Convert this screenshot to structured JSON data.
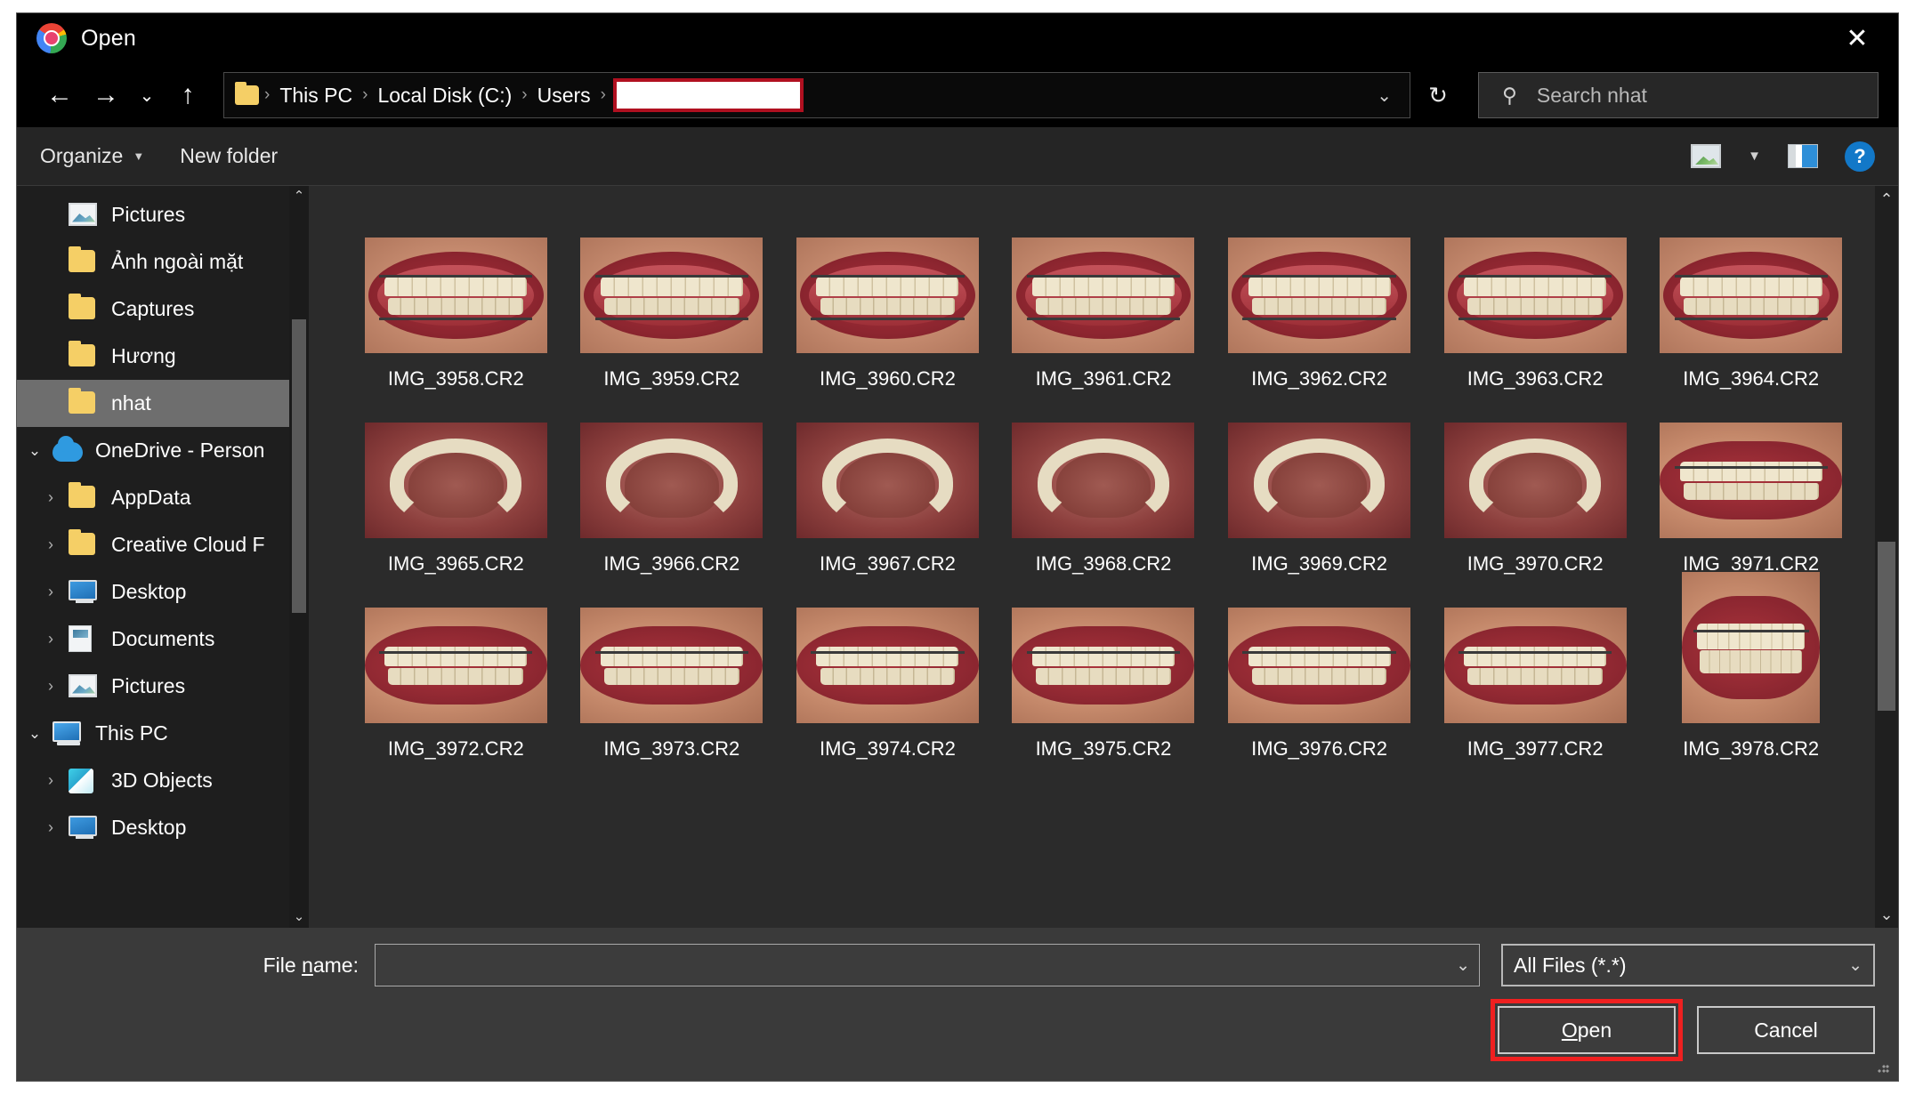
{
  "window": {
    "title": "Open",
    "app_icon": "chrome-icon",
    "close_label": "✕"
  },
  "nav": {
    "back_icon": "←",
    "forward_icon": "→",
    "recent_icon": "⌄",
    "up_icon": "↑",
    "refresh_icon": "↻",
    "address_caret": "⌄",
    "breadcrumbs": [
      {
        "label": "This PC"
      },
      {
        "label": "Local Disk (C:)"
      },
      {
        "label": "Users"
      }
    ],
    "separator": "›",
    "redacted_segment": "",
    "search_placeholder": "Search nhat",
    "search_value": "",
    "search_icon": "⚲"
  },
  "commandbar": {
    "organize_label": "Organize",
    "organize_caret": "▼",
    "new_folder_label": "New folder",
    "view_icon": "view-icon",
    "view_caret": "▼",
    "preview_pane_icon": "preview-pane-icon",
    "help_label": "?"
  },
  "sidebar": {
    "scroll_up_icon": "⌃",
    "scroll_down_icon": "⌄",
    "items": [
      {
        "label": "Pictures",
        "icon": "picture-icon",
        "indent": 1,
        "chevron": "",
        "pinned": true,
        "selected": false
      },
      {
        "label": "Ảnh ngoài mặt",
        "icon": "folder-icon",
        "indent": 1,
        "chevron": "",
        "pinned": false,
        "selected": false
      },
      {
        "label": "Captures",
        "icon": "folder-icon",
        "indent": 1,
        "chevron": "",
        "pinned": false,
        "selected": false
      },
      {
        "label": "Hương",
        "icon": "folder-icon",
        "indent": 1,
        "chevron": "",
        "pinned": false,
        "selected": false
      },
      {
        "label": "nhat",
        "icon": "folder-icon",
        "indent": 1,
        "chevron": "",
        "pinned": false,
        "selected": true
      },
      {
        "label": "OneDrive - Person",
        "icon": "cloud-icon",
        "indent": 0,
        "chevron": "⌄",
        "pinned": false,
        "selected": false
      },
      {
        "label": "AppData",
        "icon": "folder-icon",
        "indent": 1,
        "chevron": "›",
        "pinned": false,
        "selected": false
      },
      {
        "label": "Creative Cloud F",
        "icon": "folder-icon",
        "indent": 1,
        "chevron": "›",
        "pinned": false,
        "selected": false
      },
      {
        "label": "Desktop",
        "icon": "desktop-icon",
        "indent": 1,
        "chevron": "›",
        "pinned": false,
        "selected": false
      },
      {
        "label": "Documents",
        "icon": "documents-icon",
        "indent": 1,
        "chevron": "›",
        "pinned": false,
        "selected": false
      },
      {
        "label": "Pictures",
        "icon": "picture-icon",
        "indent": 1,
        "chevron": "›",
        "pinned": false,
        "selected": false
      },
      {
        "label": "This PC",
        "icon": "this-pc-icon",
        "indent": 0,
        "chevron": "⌄",
        "pinned": false,
        "selected": false
      },
      {
        "label": "3D Objects",
        "icon": "3d-objects-icon",
        "indent": 1,
        "chevron": "›",
        "pinned": false,
        "selected": false
      },
      {
        "label": "Desktop",
        "icon": "desktop-icon",
        "indent": 1,
        "chevron": "›",
        "pinned": false,
        "selected": false
      }
    ]
  },
  "files": {
    "scroll_up_icon": "⌃",
    "scroll_down_icon": "⌄",
    "items": [
      {
        "name": "IMG_3958.CR2",
        "thumb": "frontal-bite"
      },
      {
        "name": "IMG_3959.CR2",
        "thumb": "frontal-bite"
      },
      {
        "name": "IMG_3960.CR2",
        "thumb": "frontal-bite"
      },
      {
        "name": "IMG_3961.CR2",
        "thumb": "frontal-bite"
      },
      {
        "name": "IMG_3962.CR2",
        "thumb": "frontal-bite"
      },
      {
        "name": "IMG_3963.CR2",
        "thumb": "frontal-bite"
      },
      {
        "name": "IMG_3964.CR2",
        "thumb": "frontal-bite"
      },
      {
        "name": "IMG_3965.CR2",
        "thumb": "occlusal-upper"
      },
      {
        "name": "IMG_3966.CR2",
        "thumb": "occlusal-upper"
      },
      {
        "name": "IMG_3967.CR2",
        "thumb": "occlusal-upper"
      },
      {
        "name": "IMG_3968.CR2",
        "thumb": "occlusal-upper"
      },
      {
        "name": "IMG_3969.CR2",
        "thumb": "occlusal-lower"
      },
      {
        "name": "IMG_3970.CR2",
        "thumb": "occlusal-lower"
      },
      {
        "name": "IMG_3971.CR2",
        "thumb": "lateral-bite"
      },
      {
        "name": "IMG_3972.CR2",
        "thumb": "lateral-bite"
      },
      {
        "name": "IMG_3973.CR2",
        "thumb": "lateral-bite"
      },
      {
        "name": "IMG_3974.CR2",
        "thumb": "lateral-bite"
      },
      {
        "name": "IMG_3975.CR2",
        "thumb": "lateral-bite"
      },
      {
        "name": "IMG_3976.CR2",
        "thumb": "lateral-bite"
      },
      {
        "name": "IMG_3977.CR2",
        "thumb": "lateral-bite"
      },
      {
        "name": "IMG_3978.CR2",
        "thumb": "portrait-bite"
      }
    ]
  },
  "footer": {
    "filename_label_pre": "File ",
    "filename_label_accel": "n",
    "filename_label_post": "ame:",
    "filename_value": "",
    "filename_caret": "⌄",
    "filetype_value": "All Files (*.*)",
    "filetype_caret": "⌄",
    "open_accel": "O",
    "open_rest": "pen",
    "cancel_label": "Cancel"
  },
  "colors": {
    "accent_red": "#ef2020",
    "redaction_border": "#b01020",
    "selection": "#6e6e6e",
    "help_blue": "#1278c8"
  }
}
